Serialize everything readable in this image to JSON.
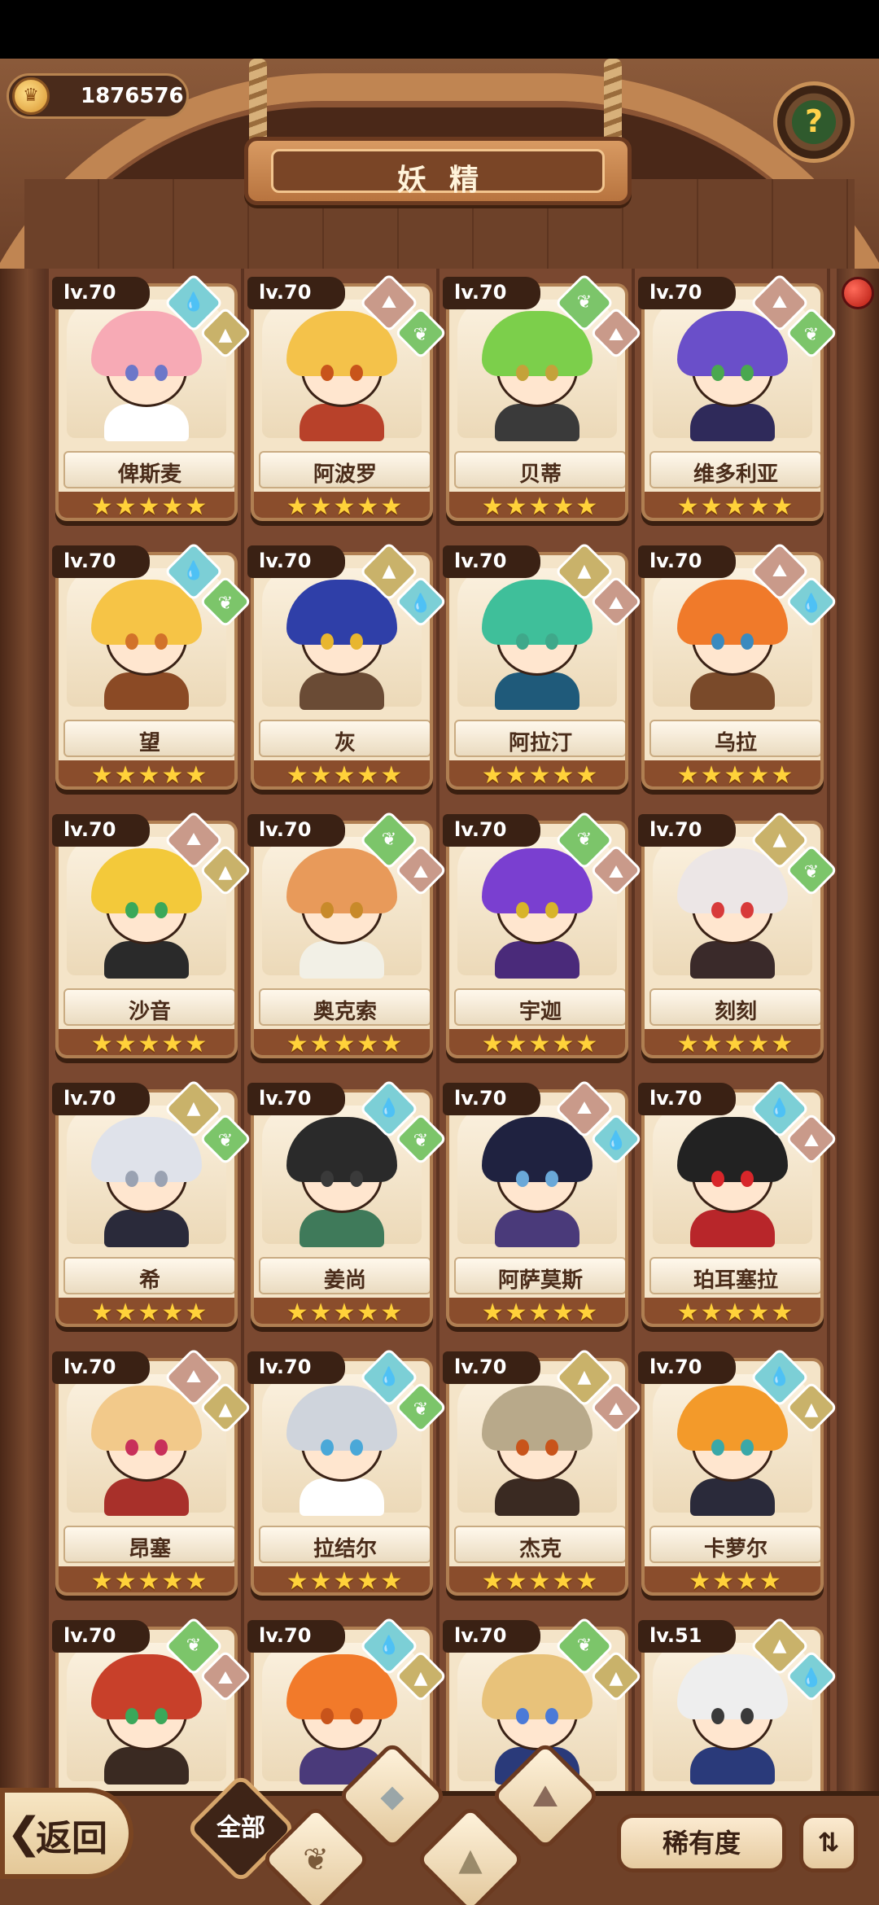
{
  "currency": {
    "value": "1876576",
    "icon": "crown-coin-icon"
  },
  "title": "妖精",
  "help_icon": "question-sprout-icon",
  "back": {
    "arrow": "❮",
    "label": "返回"
  },
  "filters": {
    "all_label": "全部",
    "icons": [
      "sprout-icon",
      "water-drop-icon",
      "mountain-icon",
      "peak-icon"
    ]
  },
  "rarity_label": "稀有度",
  "sort_icon": "sort-icon",
  "element_colors": {
    "water": "#7ccfd6",
    "earth": "#c9b26a",
    "fire": "#c99a8a",
    "leaf": "#7cc56a"
  },
  "cards": [
    {
      "lv": "lv.70",
      "name": "俾斯麦",
      "stars": "★★★★★",
      "e1": "water",
      "e2": "earth",
      "hair": "#f7aab5",
      "outfit": "#ffffff",
      "eyes": "#6c77c9"
    },
    {
      "lv": "lv.70",
      "name": "阿波罗",
      "stars": "★★★★★",
      "e1": "fire",
      "e2": "leaf",
      "hair": "#f4c24a",
      "outfit": "#b8412a",
      "eyes": "#c8541b"
    },
    {
      "lv": "lv.70",
      "name": "贝蒂",
      "stars": "★★★★★",
      "e1": "leaf",
      "e2": "fire",
      "hair": "#7ccf4b",
      "outfit": "#3a3a3a",
      "eyes": "#c4a23a"
    },
    {
      "lv": "lv.70",
      "name": "维多利亚",
      "stars": "★★★★★",
      "e1": "fire",
      "e2": "leaf",
      "hair": "#6a4fc9",
      "outfit": "#2f2a5a",
      "eyes": "#4aa84f"
    },
    {
      "lv": "lv.70",
      "name": "望",
      "stars": "★★★★★",
      "e1": "water",
      "e2": "leaf",
      "hair": "#f6c446",
      "outfit": "#8b4a25",
      "eyes": "#d2722a"
    },
    {
      "lv": "lv.70",
      "name": "灰",
      "stars": "★★★★★",
      "e1": "earth",
      "e2": "water",
      "hair": "#2f3fa8",
      "outfit": "#6a4b35",
      "eyes": "#e8b62f"
    },
    {
      "lv": "lv.70",
      "name": "阿拉汀",
      "stars": "★★★★★",
      "e1": "earth",
      "e2": "fire",
      "hair": "#3fbf9a",
      "outfit": "#1f5a7a",
      "eyes": "#3fa88a"
    },
    {
      "lv": "lv.70",
      "name": "乌拉",
      "stars": "★★★★★",
      "e1": "fire",
      "e2": "water",
      "hair": "#f07a2a",
      "outfit": "#7a4a2a",
      "eyes": "#3a8abf"
    },
    {
      "lv": "lv.70",
      "name": "沙音",
      "stars": "★★★★★",
      "e1": "fire",
      "e2": "earth",
      "hair": "#f3c93a",
      "outfit": "#2a2a2a",
      "eyes": "#3aa85a"
    },
    {
      "lv": "lv.70",
      "name": "奥克索",
      "stars": "★★★★★",
      "e1": "leaf",
      "e2": "fire",
      "hair": "#e89a5a",
      "outfit": "#f2f0e6",
      "eyes": "#c88a2a"
    },
    {
      "lv": "lv.70",
      "name": "宇迦",
      "stars": "★★★★★",
      "e1": "leaf",
      "e2": "fire",
      "hair": "#7a3fd0",
      "outfit": "#4a2a7a",
      "eyes": "#d8b42a"
    },
    {
      "lv": "lv.70",
      "name": "刻刻",
      "stars": "★★★★★",
      "e1": "earth",
      "e2": "leaf",
      "hair": "#ece6e6",
      "outfit": "#3a2a2a",
      "eyes": "#d83a3a"
    },
    {
      "lv": "lv.70",
      "name": "希",
      "stars": "★★★★★",
      "e1": "earth",
      "e2": "leaf",
      "hair": "#dfe2ea",
      "outfit": "#2a2a3a",
      "eyes": "#9aa2b2"
    },
    {
      "lv": "lv.70",
      "name": "姜尚",
      "stars": "★★★★★",
      "e1": "water",
      "e2": "leaf",
      "hair": "#2a2a2a",
      "outfit": "#3f7a5a",
      "eyes": "#3a3a3a"
    },
    {
      "lv": "lv.70",
      "name": "阿萨莫斯",
      "stars": "★★★★★",
      "e1": "fire",
      "e2": "water",
      "hair": "#1f2240",
      "outfit": "#4a3a7a",
      "eyes": "#6aa8d8"
    },
    {
      "lv": "lv.70",
      "name": "珀耳塞拉",
      "stars": "★★★★★",
      "e1": "water",
      "e2": "fire",
      "hair": "#222222",
      "outfit": "#b8262a",
      "eyes": "#d8262a"
    },
    {
      "lv": "lv.70",
      "name": "昂塞",
      "stars": "★★★★★",
      "e1": "fire",
      "e2": "earth",
      "hair": "#f2c98a",
      "outfit": "#a8302a",
      "eyes": "#c8305a"
    },
    {
      "lv": "lv.70",
      "name": "拉结尔",
      "stars": "★★★★★",
      "e1": "water",
      "e2": "leaf",
      "hair": "#cfd4dc",
      "outfit": "#ffffff",
      "eyes": "#4aa8d8"
    },
    {
      "lv": "lv.70",
      "name": "杰克",
      "stars": "★★★★★",
      "e1": "earth",
      "e2": "fire",
      "hair": "#b8a98a",
      "outfit": "#3a2a22",
      "eyes": "#c8541b"
    },
    {
      "lv": "lv.70",
      "name": "卡萝尔",
      "stars": "★★★★",
      "e1": "water",
      "e2": "earth",
      "hair": "#f39a2a",
      "outfit": "#2a2a3a",
      "eyes": "#3aa8a8"
    },
    {
      "lv": "lv.70",
      "name": "",
      "stars": "",
      "e1": "leaf",
      "e2": "fire",
      "hair": "#c8402a",
      "outfit": "#3a2a22",
      "eyes": "#3aa85a"
    },
    {
      "lv": "lv.70",
      "name": "",
      "stars": "",
      "e1": "water",
      "e2": "earth",
      "hair": "#f27a2a",
      "outfit": "#4a3a7a",
      "eyes": "#c8541b"
    },
    {
      "lv": "lv.70",
      "name": "",
      "stars": "",
      "e1": "leaf",
      "e2": "earth",
      "hair": "#e8c27a",
      "outfit": "#2a3a7a",
      "eyes": "#4a7ad8"
    },
    {
      "lv": "lv.51",
      "name": "",
      "stars": "",
      "e1": "earth",
      "e2": "water",
      "hair": "#eeeeee",
      "outfit": "#2a3a7a",
      "eyes": "#3a3a3a"
    }
  ]
}
